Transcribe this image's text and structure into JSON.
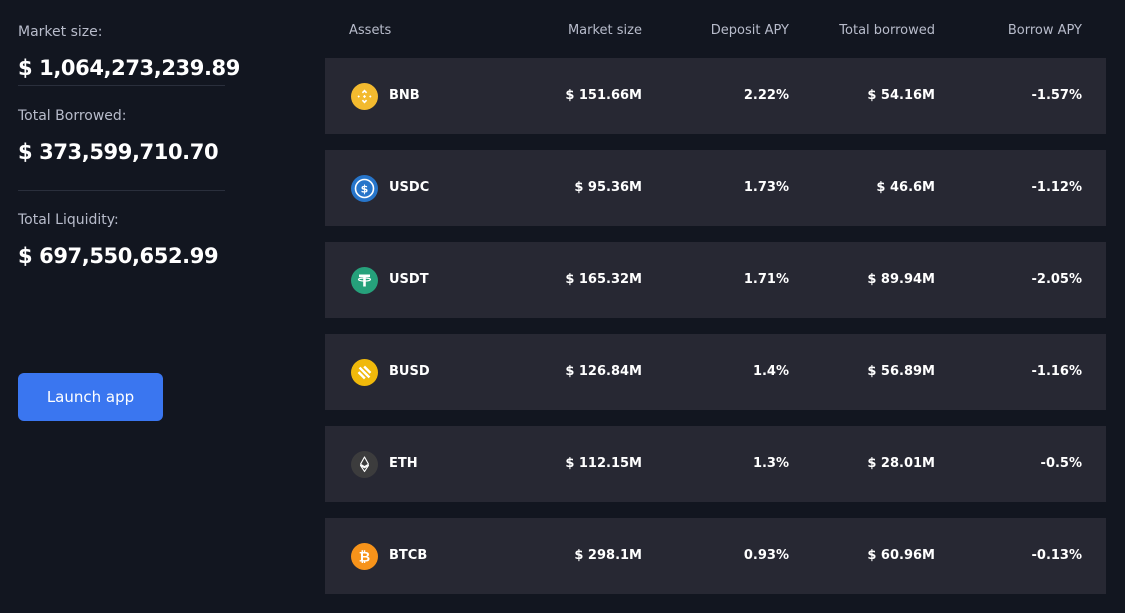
{
  "stats": {
    "market_size": {
      "label": "Market size:",
      "value": "$ 1,064,273,239.89"
    },
    "total_borrowed": {
      "label": "Total Borrowed:",
      "value": "$ 373,599,710.70"
    },
    "total_liquidity": {
      "label": "Total Liquidity:",
      "value": "$ 697,550,652.99"
    }
  },
  "launch_button": {
    "label": "Launch app",
    "color": "#3a76f0"
  },
  "table": {
    "headers": {
      "assets": "Assets",
      "market_size": "Market size",
      "deposit_apy": "Deposit APY",
      "total_borrowed": "Total borrowed",
      "borrow_apy": "Borrow APY"
    },
    "rows": [
      {
        "asset": "BNB",
        "icon": "bnb-icon",
        "icon_color": "#f3ba2f",
        "market_size": "$ 151.66M",
        "deposit_apy": "2.22%",
        "total_borrowed": "$ 54.16M",
        "borrow_apy": "-1.57%"
      },
      {
        "asset": "USDC",
        "icon": "usdc-icon",
        "icon_color": "#2775ca",
        "market_size": "$ 95.36M",
        "deposit_apy": "1.73%",
        "total_borrowed": "$ 46.6M",
        "borrow_apy": "-1.12%"
      },
      {
        "asset": "USDT",
        "icon": "usdt-icon",
        "icon_color": "#26a17b",
        "market_size": "$ 165.32M",
        "deposit_apy": "1.71%",
        "total_borrowed": "$ 89.94M",
        "borrow_apy": "-2.05%"
      },
      {
        "asset": "BUSD",
        "icon": "busd-icon",
        "icon_color": "#f0b90b",
        "market_size": "$ 126.84M",
        "deposit_apy": "1.4%",
        "total_borrowed": "$ 56.89M",
        "borrow_apy": "-1.16%"
      },
      {
        "asset": "ETH",
        "icon": "eth-icon",
        "icon_color": "#3c3c3d",
        "market_size": "$ 112.15M",
        "deposit_apy": "1.3%",
        "total_borrowed": "$ 28.01M",
        "borrow_apy": "-0.5%"
      },
      {
        "asset": "BTCB",
        "icon": "btcb-icon",
        "icon_color": "#f7931a",
        "market_size": "$ 298.1M",
        "deposit_apy": "0.93%",
        "total_borrowed": "$ 60.96M",
        "borrow_apy": "-0.13%"
      }
    ]
  }
}
